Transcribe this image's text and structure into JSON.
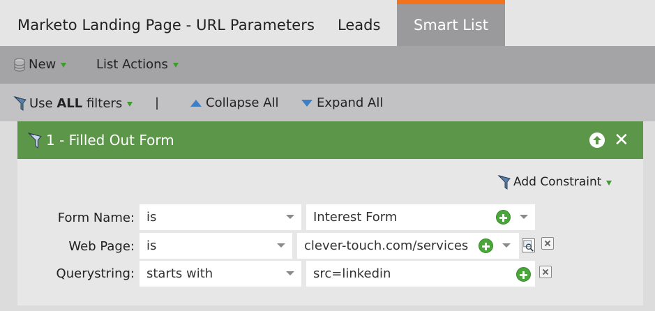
{
  "tabs": {
    "page_title": "Marketo Landing Page - URL Parameters",
    "leads": "Leads",
    "smart_list": "Smart List"
  },
  "toolbar": {
    "new_label": "New",
    "list_actions_label": "List Actions"
  },
  "filter_bar": {
    "use_prefix": "Use ",
    "use_bold": "ALL",
    "use_suffix": " filters",
    "separator": "|",
    "collapse_all": "Collapse All",
    "expand_all": "Expand All"
  },
  "filter_card": {
    "title": "1 - Filled Out Form",
    "add_constraint": "Add Constraint",
    "rows": [
      {
        "label": "Form Name:",
        "operator": "is",
        "value": "Interest Form"
      },
      {
        "label": "Web Page:",
        "operator": "is",
        "value": "clever-touch.com/services"
      },
      {
        "label": "Querystring:",
        "operator": "starts with",
        "value": "src=linkedin"
      }
    ]
  },
  "colors": {
    "active_tab_accent": "#f2731c",
    "filter_header": "#5c9649",
    "add_icon": "#4aa63a",
    "arrow_blue": "#3d7fc4"
  }
}
